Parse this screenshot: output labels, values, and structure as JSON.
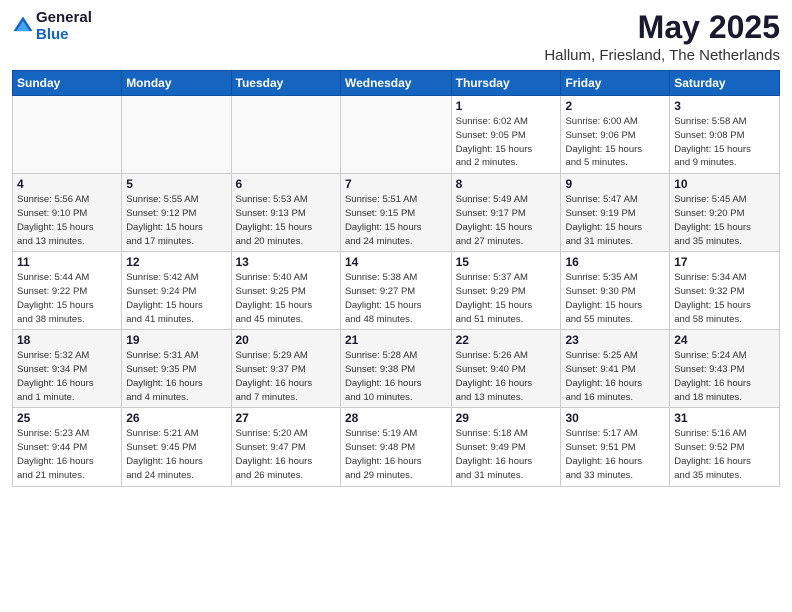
{
  "logo": {
    "general": "General",
    "blue": "Blue"
  },
  "title": "May 2025",
  "location": "Hallum, Friesland, The Netherlands",
  "weekdays": [
    "Sunday",
    "Monday",
    "Tuesday",
    "Wednesday",
    "Thursday",
    "Friday",
    "Saturday"
  ],
  "weeks": [
    [
      {
        "day": "",
        "info": ""
      },
      {
        "day": "",
        "info": ""
      },
      {
        "day": "",
        "info": ""
      },
      {
        "day": "",
        "info": ""
      },
      {
        "day": "1",
        "info": "Sunrise: 6:02 AM\nSunset: 9:05 PM\nDaylight: 15 hours\nand 2 minutes."
      },
      {
        "day": "2",
        "info": "Sunrise: 6:00 AM\nSunset: 9:06 PM\nDaylight: 15 hours\nand 5 minutes."
      },
      {
        "day": "3",
        "info": "Sunrise: 5:58 AM\nSunset: 9:08 PM\nDaylight: 15 hours\nand 9 minutes."
      }
    ],
    [
      {
        "day": "4",
        "info": "Sunrise: 5:56 AM\nSunset: 9:10 PM\nDaylight: 15 hours\nand 13 minutes."
      },
      {
        "day": "5",
        "info": "Sunrise: 5:55 AM\nSunset: 9:12 PM\nDaylight: 15 hours\nand 17 minutes."
      },
      {
        "day": "6",
        "info": "Sunrise: 5:53 AM\nSunset: 9:13 PM\nDaylight: 15 hours\nand 20 minutes."
      },
      {
        "day": "7",
        "info": "Sunrise: 5:51 AM\nSunset: 9:15 PM\nDaylight: 15 hours\nand 24 minutes."
      },
      {
        "day": "8",
        "info": "Sunrise: 5:49 AM\nSunset: 9:17 PM\nDaylight: 15 hours\nand 27 minutes."
      },
      {
        "day": "9",
        "info": "Sunrise: 5:47 AM\nSunset: 9:19 PM\nDaylight: 15 hours\nand 31 minutes."
      },
      {
        "day": "10",
        "info": "Sunrise: 5:45 AM\nSunset: 9:20 PM\nDaylight: 15 hours\nand 35 minutes."
      }
    ],
    [
      {
        "day": "11",
        "info": "Sunrise: 5:44 AM\nSunset: 9:22 PM\nDaylight: 15 hours\nand 38 minutes."
      },
      {
        "day": "12",
        "info": "Sunrise: 5:42 AM\nSunset: 9:24 PM\nDaylight: 15 hours\nand 41 minutes."
      },
      {
        "day": "13",
        "info": "Sunrise: 5:40 AM\nSunset: 9:25 PM\nDaylight: 15 hours\nand 45 minutes."
      },
      {
        "day": "14",
        "info": "Sunrise: 5:38 AM\nSunset: 9:27 PM\nDaylight: 15 hours\nand 48 minutes."
      },
      {
        "day": "15",
        "info": "Sunrise: 5:37 AM\nSunset: 9:29 PM\nDaylight: 15 hours\nand 51 minutes."
      },
      {
        "day": "16",
        "info": "Sunrise: 5:35 AM\nSunset: 9:30 PM\nDaylight: 15 hours\nand 55 minutes."
      },
      {
        "day": "17",
        "info": "Sunrise: 5:34 AM\nSunset: 9:32 PM\nDaylight: 15 hours\nand 58 minutes."
      }
    ],
    [
      {
        "day": "18",
        "info": "Sunrise: 5:32 AM\nSunset: 9:34 PM\nDaylight: 16 hours\nand 1 minute."
      },
      {
        "day": "19",
        "info": "Sunrise: 5:31 AM\nSunset: 9:35 PM\nDaylight: 16 hours\nand 4 minutes."
      },
      {
        "day": "20",
        "info": "Sunrise: 5:29 AM\nSunset: 9:37 PM\nDaylight: 16 hours\nand 7 minutes."
      },
      {
        "day": "21",
        "info": "Sunrise: 5:28 AM\nSunset: 9:38 PM\nDaylight: 16 hours\nand 10 minutes."
      },
      {
        "day": "22",
        "info": "Sunrise: 5:26 AM\nSunset: 9:40 PM\nDaylight: 16 hours\nand 13 minutes."
      },
      {
        "day": "23",
        "info": "Sunrise: 5:25 AM\nSunset: 9:41 PM\nDaylight: 16 hours\nand 16 minutes."
      },
      {
        "day": "24",
        "info": "Sunrise: 5:24 AM\nSunset: 9:43 PM\nDaylight: 16 hours\nand 18 minutes."
      }
    ],
    [
      {
        "day": "25",
        "info": "Sunrise: 5:23 AM\nSunset: 9:44 PM\nDaylight: 16 hours\nand 21 minutes."
      },
      {
        "day": "26",
        "info": "Sunrise: 5:21 AM\nSunset: 9:45 PM\nDaylight: 16 hours\nand 24 minutes."
      },
      {
        "day": "27",
        "info": "Sunrise: 5:20 AM\nSunset: 9:47 PM\nDaylight: 16 hours\nand 26 minutes."
      },
      {
        "day": "28",
        "info": "Sunrise: 5:19 AM\nSunset: 9:48 PM\nDaylight: 16 hours\nand 29 minutes."
      },
      {
        "day": "29",
        "info": "Sunrise: 5:18 AM\nSunset: 9:49 PM\nDaylight: 16 hours\nand 31 minutes."
      },
      {
        "day": "30",
        "info": "Sunrise: 5:17 AM\nSunset: 9:51 PM\nDaylight: 16 hours\nand 33 minutes."
      },
      {
        "day": "31",
        "info": "Sunrise: 5:16 AM\nSunset: 9:52 PM\nDaylight: 16 hours\nand 35 minutes."
      }
    ]
  ]
}
